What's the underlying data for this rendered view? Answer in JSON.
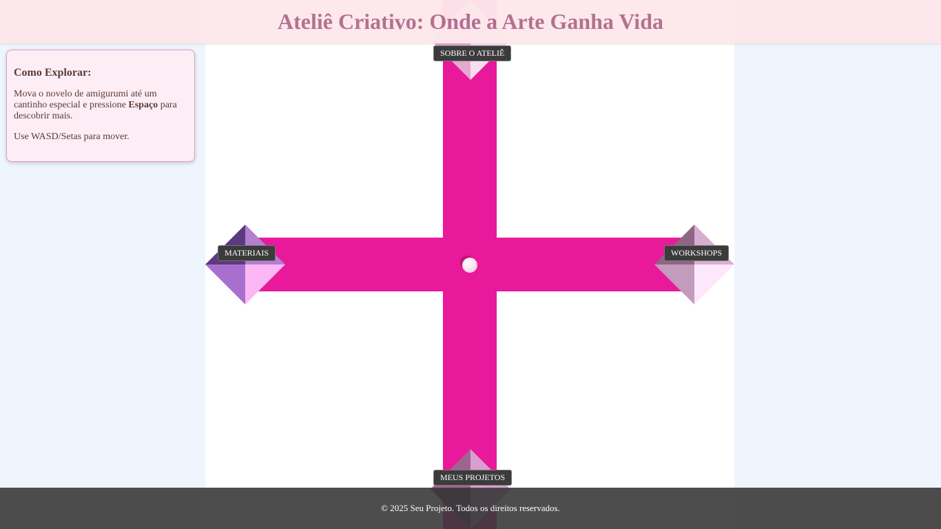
{
  "header": {
    "title": "Ateliê Criativo: Onde a Arte Ganha Vida"
  },
  "instructions": {
    "heading": "Como Explorar:",
    "line1_prefix": "Mova o novelo de amigurumi até um cantinho especial e pressione ",
    "line1_key": "Espaço",
    "line1_suffix": " para descobrir mais.",
    "line2": "Use WASD/Setas para mover."
  },
  "game": {
    "road_color": "#e8199a",
    "player": {
      "name": "novelo de amigurumi",
      "icon": "yarn-ball-icon"
    },
    "destinations": {
      "top": {
        "label": "SOBRE O ATELIÊ"
      },
      "left": {
        "label": "MATERIAIS"
      },
      "right": {
        "label": "WORKSHOPS"
      },
      "bottom": {
        "label": "MEUS PROJETOS"
      }
    }
  },
  "footer": {
    "text": "© 2025 Seu Projeto. Todos os direitos reservados."
  }
}
